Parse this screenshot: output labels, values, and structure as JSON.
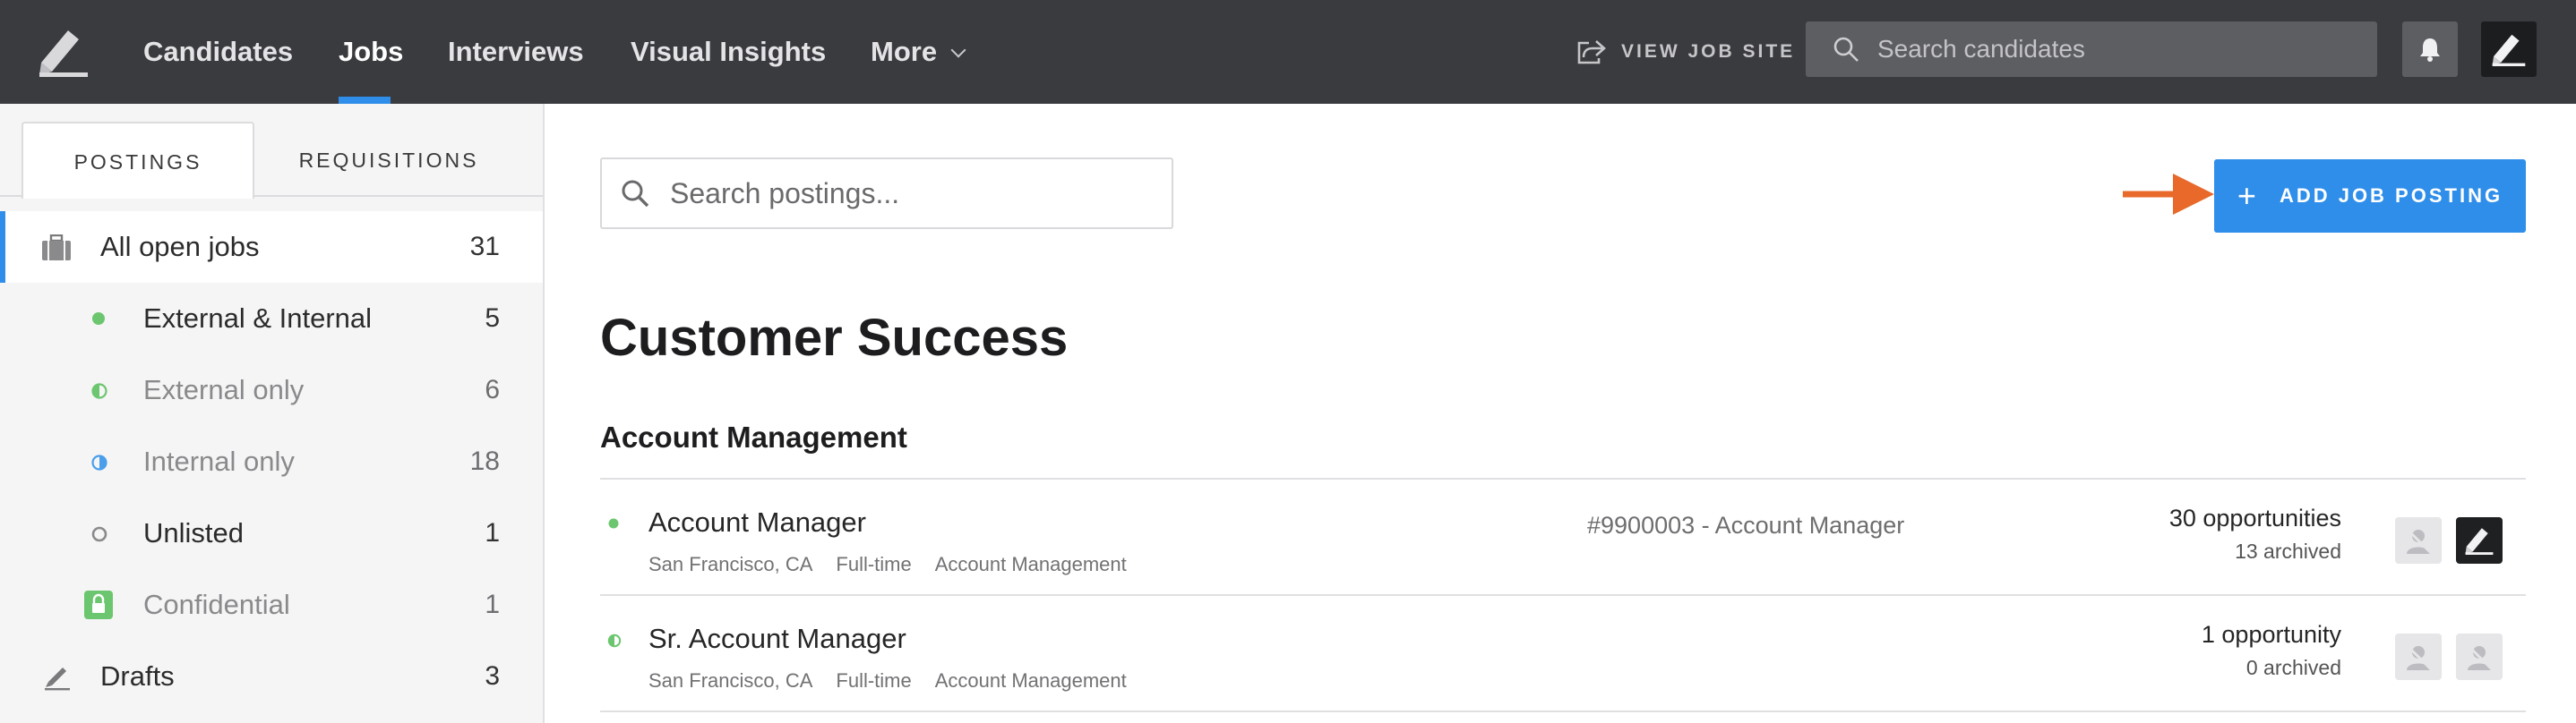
{
  "topnav": {
    "items": [
      {
        "label": "Candidates"
      },
      {
        "label": "Jobs",
        "active": true
      },
      {
        "label": "Interviews"
      },
      {
        "label": "Visual Insights"
      },
      {
        "label": "More"
      }
    ],
    "view_job_site": "VIEW JOB SITE",
    "search_placeholder": "Search candidates"
  },
  "sidebar": {
    "tabs": [
      {
        "label": "POSTINGS",
        "active": true
      },
      {
        "label": "REQUISITIONS"
      }
    ],
    "items": [
      {
        "label": "All open jobs",
        "count": "31",
        "icon": "briefcase-icon",
        "selected": true
      },
      {
        "label": "External & Internal",
        "count": "5",
        "icon": "full-dot-icon"
      },
      {
        "label": "External only",
        "count": "6",
        "icon": "half-dot-green-icon"
      },
      {
        "label": "Internal only",
        "count": "18",
        "icon": "half-dot-blue-icon"
      },
      {
        "label": "Unlisted",
        "count": "1",
        "icon": "ring-icon"
      },
      {
        "label": "Confidential",
        "count": "1",
        "icon": "lock-icon"
      },
      {
        "label": "Drafts",
        "count": "3",
        "icon": "pencil-icon"
      }
    ]
  },
  "main": {
    "search_placeholder": "Search postings...",
    "add_button": "ADD JOB POSTING",
    "department": "Customer Success",
    "team": "Account Management",
    "jobs": [
      {
        "title": "Account Manager",
        "location": "San Francisco, CA",
        "type": "Full-time",
        "team": "Account Management",
        "requisition": "#9900003 - Account Manager",
        "opportunities": "30 opportunities",
        "archived": "13 archived"
      },
      {
        "title": "Sr. Account Manager",
        "location": "San Francisco, CA",
        "type": "Full-time",
        "team": "Account Management",
        "requisition": "",
        "opportunities": "1 opportunity",
        "archived": "0 archived"
      }
    ]
  },
  "colors": {
    "topbar": "#3a3b3e",
    "accent": "#2f8ee9",
    "arrow": "#e8692a",
    "green": "#6cc66f",
    "blue": "#4a9eea"
  }
}
